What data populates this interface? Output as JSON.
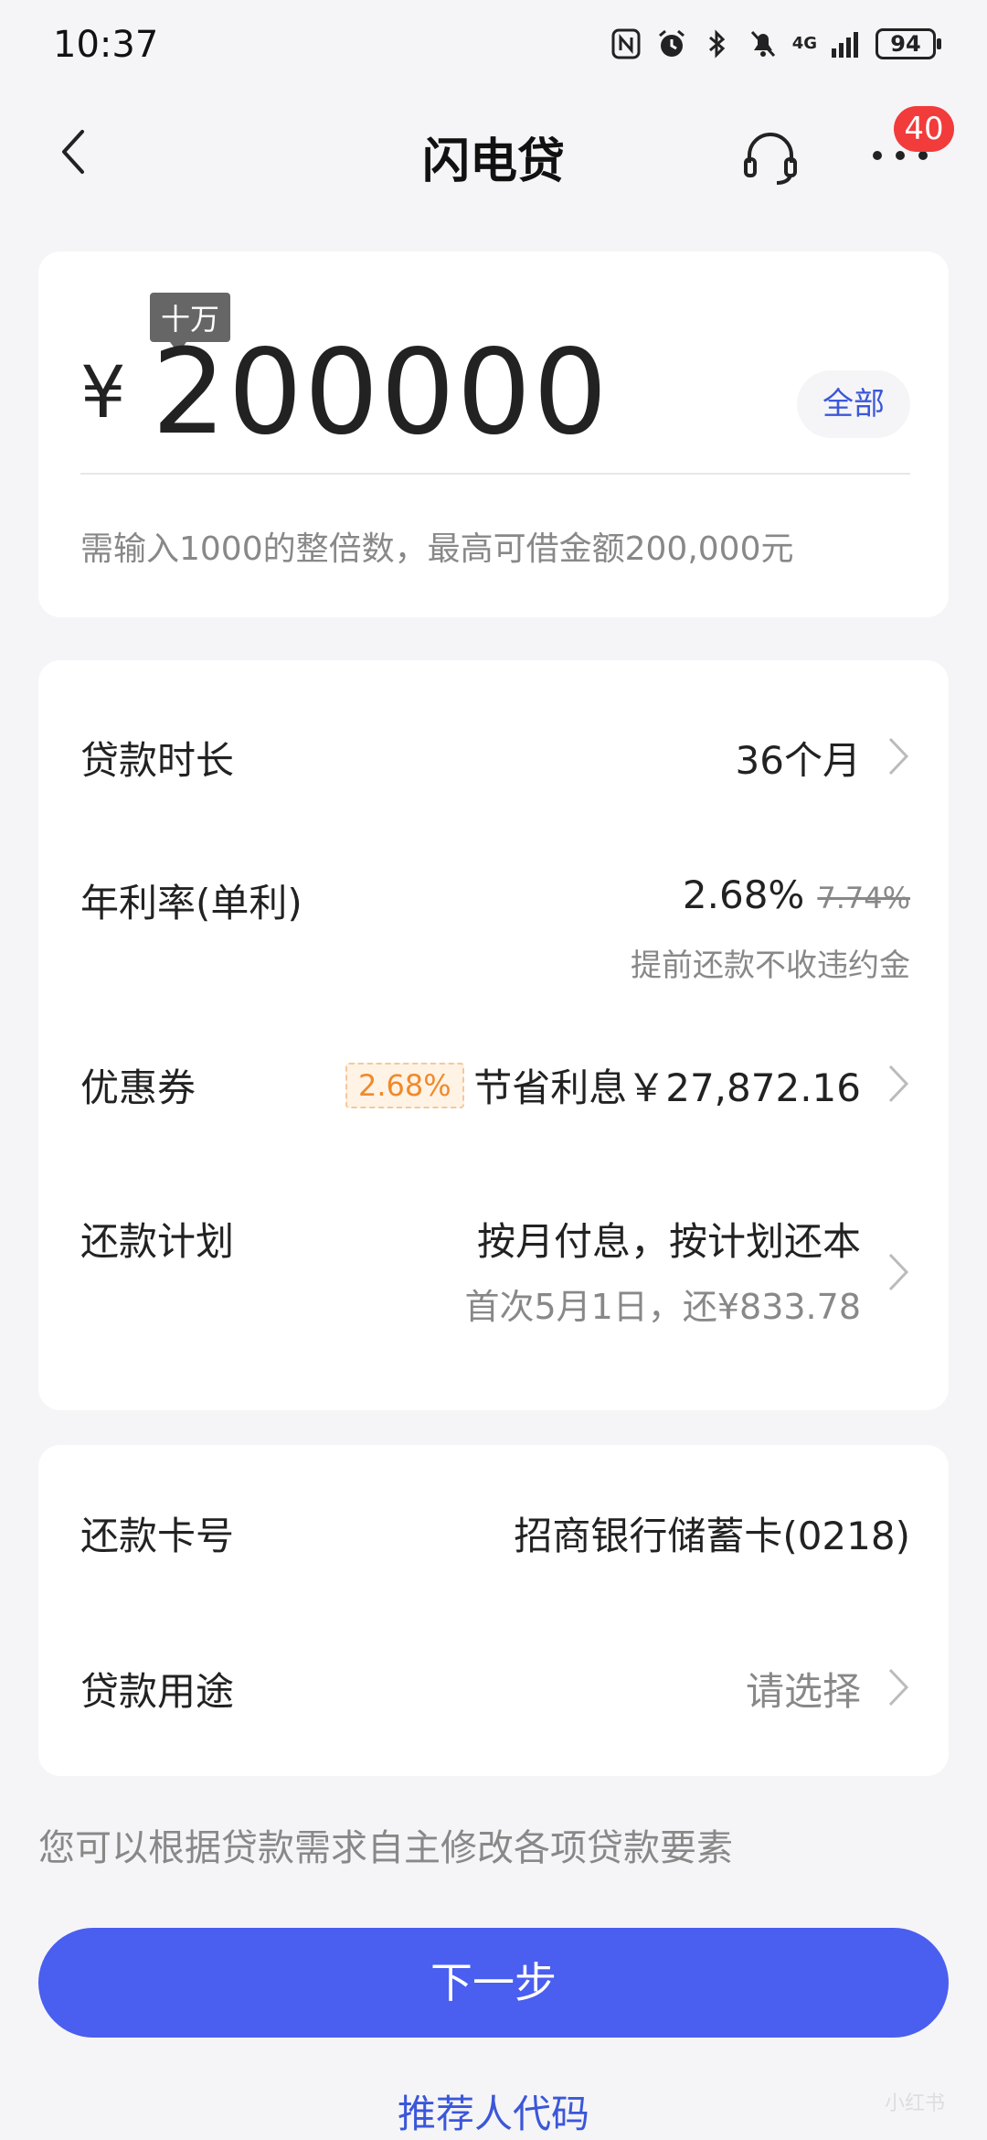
{
  "status_bar": {
    "time": "10:37",
    "network": "4G",
    "battery": "94"
  },
  "nav": {
    "title": "闪电贷",
    "badge_count": "40"
  },
  "amount_card": {
    "unit_tag": "十万",
    "currency": "¥",
    "amount": "200000",
    "all_label": "全部",
    "hint": "需输入1000的整倍数，最高可借金额200,000元"
  },
  "loan_card": {
    "term": {
      "label": "贷款时长",
      "value": "36个月"
    },
    "rate": {
      "label": "年利率(单利)",
      "value": "2.68%",
      "original": "7.74%",
      "note": "提前还款不收违约金"
    },
    "coupon": {
      "label": "优惠券",
      "tag": "2.68%",
      "value": "节省利息￥27,872.16"
    },
    "plan": {
      "label": "还款计划",
      "value": "按月付息，按计划还本",
      "note": "首次5月1日，还¥833.78"
    }
  },
  "bank_card": {
    "card": {
      "label": "还款卡号",
      "value": "招商银行储蓄卡(0218)"
    },
    "purpose": {
      "label": "贷款用途",
      "value": "请选择"
    }
  },
  "bottom_note": "您可以根据贷款需求自主修改各项贷款要素",
  "next_label": "下一步",
  "referrer_label": "推荐人代码",
  "watermark": "小红书"
}
